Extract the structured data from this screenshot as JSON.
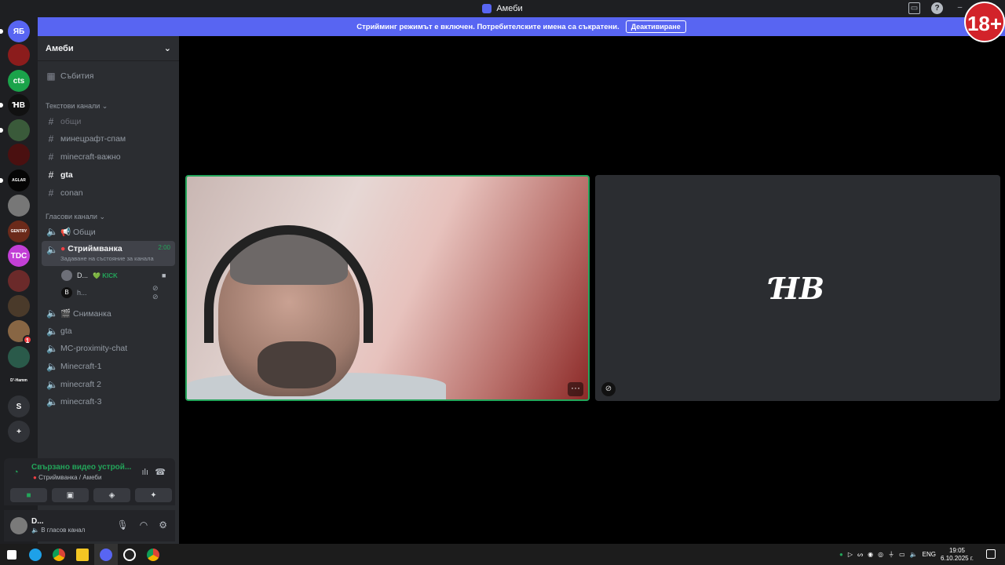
{
  "window": {
    "title": "Амеби",
    "age_rating": "18+"
  },
  "banner": {
    "text": "Стрийминг режимът е включен. Потребителските имена са съкратени.",
    "button": "Деактивиране"
  },
  "guilds": [
    {
      "label": "ЯБ",
      "color": "#5865f2"
    },
    {
      "label": "",
      "color": "#8b1c1c"
    },
    {
      "label": "cts",
      "color": "#1aa34a"
    },
    {
      "label": "ꞪB",
      "color": "#111111"
    },
    {
      "label": "",
      "color": "#3a5a3a"
    },
    {
      "label": "",
      "color": "#4a1010"
    },
    {
      "label": "AGLAR",
      "color": "#050505"
    },
    {
      "label": "",
      "color": "#777777"
    },
    {
      "label": "GENTRY",
      "color": "#6b2a1a"
    },
    {
      "label": "TDC",
      "color": "#c23fd6"
    },
    {
      "label": "",
      "color": "#6b2a2a"
    },
    {
      "label": "",
      "color": "#4a3a2a"
    },
    {
      "label": "",
      "color": "#886644",
      "badge": "1"
    },
    {
      "label": "",
      "color": "#2a5a4a"
    },
    {
      "label": "D'-Hamm",
      "color": "#1e1f22"
    },
    {
      "label": "S",
      "color": "#313338"
    },
    {
      "label": "+",
      "color": "#313338"
    }
  ],
  "server": {
    "name": "Амеби",
    "events": "Събития",
    "text_category": "Текстови канали",
    "text_channels": [
      "общи",
      "минецрафт-спам",
      "minecraft-важно",
      "gta",
      "conan"
    ],
    "voice_category": "Гласови канали",
    "voice_channels": {
      "general": "📢 Общи",
      "streaming": "Стриймванка",
      "streaming_timer": "2:00",
      "streaming_status": "Задаване на състояние за канала",
      "members": [
        {
          "name": "D...",
          "tag": "💚 KICK"
        },
        {
          "name": "h...",
          "tag": ""
        }
      ],
      "others": [
        "🎬 Сниманка",
        "gta",
        "MC-proximity-chat",
        "Minecraft-1",
        "minecraft 2",
        "minecraft-3"
      ]
    }
  },
  "voice_panel": {
    "status": "Свързано видео устрой...",
    "sub": "Стриймванка / Амеби"
  },
  "user_panel": {
    "name": "D...",
    "status": "В гласов канал"
  },
  "taskbar": {
    "lang": "ENG",
    "time": "19:05",
    "date": "6.10.2025 г."
  }
}
